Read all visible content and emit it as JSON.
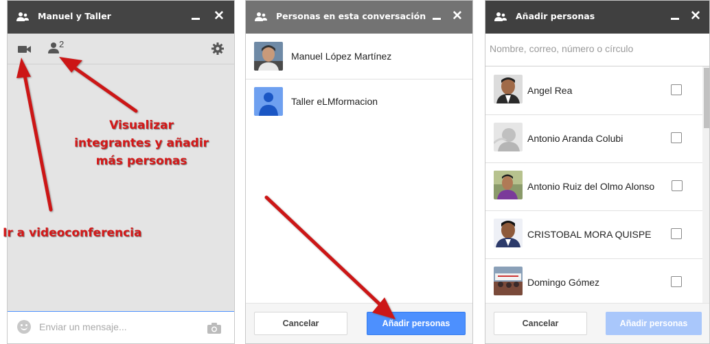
{
  "chat_panel": {
    "title": "Manuel y Taller",
    "participant_count": "2",
    "message_placeholder": "Enviar un mensaje...",
    "icons": [
      "people-icon",
      "minimize-icon",
      "close-icon",
      "video-camera-icon",
      "participants-icon",
      "gear-icon",
      "smiley-icon",
      "camera-icon"
    ]
  },
  "annotations": {
    "participants_note": "Visualizar integrantes y añadir más personas",
    "video_note": "Ir a videoconferencia",
    "color": "#d51818"
  },
  "people_panel": {
    "title": "Personas en esta conversación",
    "people": [
      {
        "name": "Manuel López Martínez"
      },
      {
        "name": "Taller eLMformacion"
      }
    ],
    "cancel_label": "Cancelar",
    "add_label": "Añadir personas"
  },
  "add_panel": {
    "title": "Añadir personas",
    "search_placeholder": "Nombre, correo, número o círculo",
    "contacts": [
      {
        "name": "Angel Rea",
        "checked": false
      },
      {
        "name": "Antonio Aranda Colubi",
        "checked": false
      },
      {
        "name": "Antonio Ruiz del Olmo Alonso",
        "checked": false
      },
      {
        "name": "CRISTOBAL MORA QUISPE",
        "checked": false
      },
      {
        "name": "Domingo Gómez",
        "checked": false
      }
    ],
    "cancel_label": "Cancelar",
    "add_label": "Añadir personas"
  },
  "colors": {
    "accent_blue": "#4d90fe",
    "title_dark": "#444444",
    "annotation_red": "#d51818"
  }
}
